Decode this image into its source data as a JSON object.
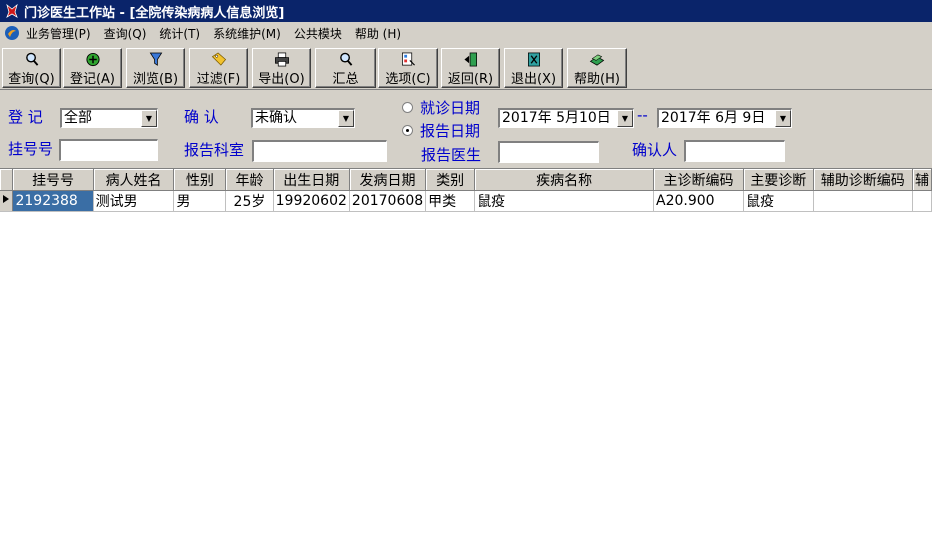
{
  "window": {
    "title": "门诊医生工作站 - [全院传染病病人信息浏览]"
  },
  "menu": [
    {
      "label": "业务管理(P)"
    },
    {
      "label": "查询(Q)"
    },
    {
      "label": "统计(T)"
    },
    {
      "label": "系统维护(M)"
    },
    {
      "label": "公共模块"
    },
    {
      "label": "帮助 (H)"
    }
  ],
  "toolbar": [
    {
      "label": "查询(Q)",
      "icon": "magnifier-icon"
    },
    {
      "label": "登记(A)",
      "icon": "add-circle-icon"
    },
    {
      "label": "浏览(B)",
      "icon": "funnel-icon"
    },
    {
      "label": "过滤(F)",
      "icon": "tag-icon"
    },
    {
      "label": "导出(O)",
      "icon": "printer-icon"
    },
    {
      "label": "汇总",
      "icon": "magnifier-icon"
    },
    {
      "label": "选项(C)",
      "icon": "options-icon"
    },
    {
      "label": "返回(R)",
      "icon": "return-icon"
    },
    {
      "label": "退出(X)",
      "icon": "exit-icon"
    },
    {
      "label": "帮助(H)",
      "icon": "book-icon"
    }
  ],
  "filters": {
    "register_label": "登 记",
    "register_value": "全部",
    "confirm_label": "确  认",
    "confirm_value": "未确认",
    "visit_date_label": "就诊日期",
    "report_date_label": "报告日期",
    "selected_date_mode": "report_date",
    "date_from": "2017年  5月10日",
    "date_sep": "--",
    "date_to": "2017年  6月  9日",
    "regno_label": "挂号号",
    "regno_value": "",
    "report_dept_label": "报告科室",
    "report_dept_value": "",
    "report_doctor_label": "报告医生",
    "report_doctor_value": "",
    "confirmer_label": "确认人",
    "confirmer_value": ""
  },
  "grid": {
    "columns": [
      "挂号号",
      "病人姓名",
      "性别",
      "年龄",
      "出生日期",
      "发病日期",
      "类别",
      "疾病名称",
      "主诊断编码",
      "主要诊断",
      "辅助诊断编码",
      "辅"
    ],
    "rows": [
      [
        "2192388",
        "测试男",
        "男",
        "25岁",
        "19920602",
        "20170608",
        "甲类",
        "鼠疫",
        "A20.900",
        "鼠疫",
        "",
        ""
      ]
    ]
  }
}
